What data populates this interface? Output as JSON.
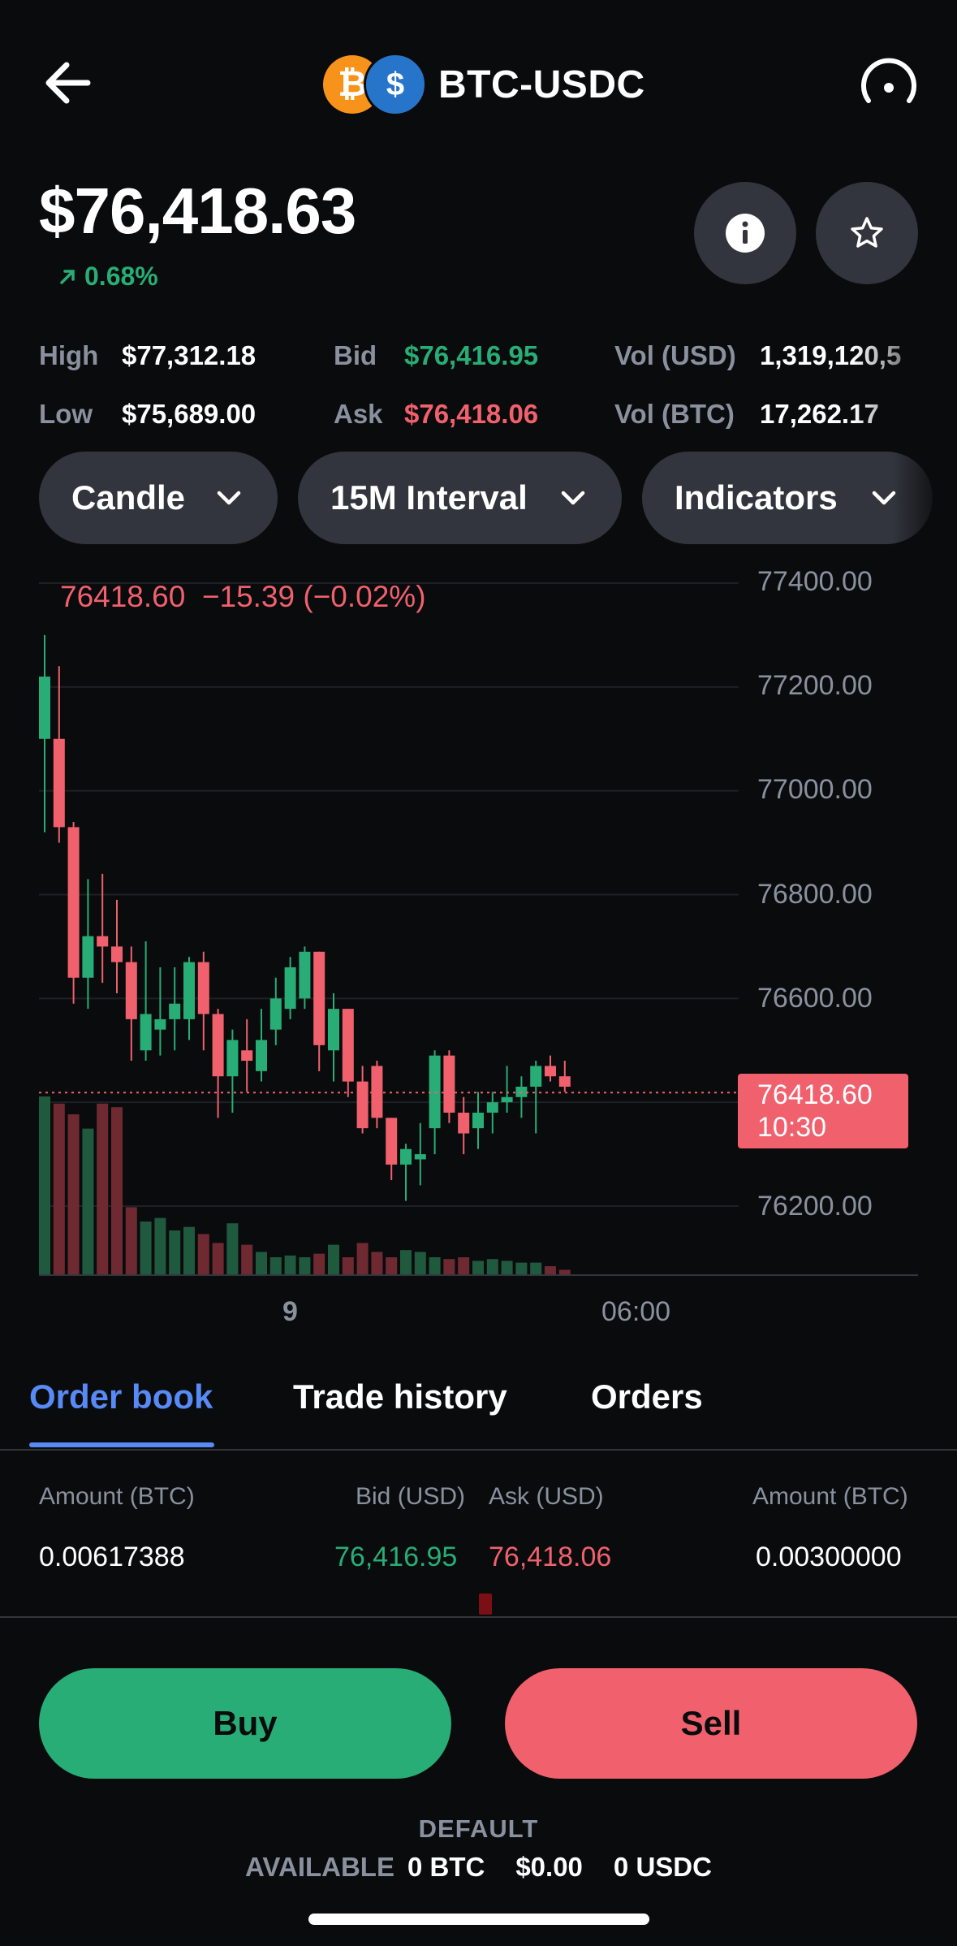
{
  "header": {
    "pair": "BTC-USDC",
    "base_symbol": "₿",
    "quote_symbol": "$"
  },
  "price": {
    "value": "$76,418.63",
    "change": "0.68%"
  },
  "stats": {
    "high_label": "High",
    "high_value": "$77,312.18",
    "low_label": "Low",
    "low_value": "$75,689.00",
    "bid_label": "Bid",
    "bid_value": "$76,416.95",
    "ask_label": "Ask",
    "ask_value": "$76,418.06",
    "vol_usd_label": "Vol (USD)",
    "vol_usd_value": "1,319,120,5",
    "vol_btc_label": "Vol (BTC)",
    "vol_btc_value": "17,262.17"
  },
  "controls": {
    "chart_type": "Candle",
    "interval": "15M Interval",
    "indicators": "Indicators"
  },
  "chart": {
    "ohlc_text": "76418.60  −15.39 (−0.02%)",
    "y_labels": [
      "77400.00",
      "77200.00",
      "77000.00",
      "76800.00",
      "76600.00",
      "76200.00"
    ],
    "x_labels": [
      "9",
      "06:00"
    ],
    "price_tag_value": "76418.60",
    "price_tag_time": "10:30",
    "colors": {
      "up": "#27ad75",
      "down": "#f0616d"
    }
  },
  "tabs": [
    "Order book",
    "Trade history",
    "Orders"
  ],
  "order_book": {
    "headers": [
      "Amount (BTC)",
      "Bid (USD)",
      "Ask (USD)",
      "Amount (BTC)"
    ],
    "row": [
      "0.00617388",
      "76,416.95",
      "76,418.06",
      "0.00300000"
    ]
  },
  "actions": {
    "buy": "Buy",
    "sell": "Sell"
  },
  "account": {
    "portfolio": "DEFAULT",
    "available_label": "AVAILABLE",
    "btc": "0 BTC",
    "usd": "$0.00",
    "usdc": "0 USDC"
  },
  "chart_data": {
    "type": "candlestick",
    "ylim": [
      76150,
      77420
    ],
    "last_price": 76418.6,
    "candles": [
      {
        "o": 77100,
        "h": 77300,
        "l": 76920,
        "c": 77220
      },
      {
        "o": 77100,
        "h": 77240,
        "l": 76900,
        "c": 76930
      },
      {
        "o": 76930,
        "h": 76940,
        "l": 76590,
        "c": 76640
      },
      {
        "o": 76640,
        "h": 76830,
        "l": 76580,
        "c": 76720
      },
      {
        "o": 76720,
        "h": 76840,
        "l": 76630,
        "c": 76700
      },
      {
        "o": 76700,
        "h": 76790,
        "l": 76610,
        "c": 76670
      },
      {
        "o": 76670,
        "h": 76700,
        "l": 76480,
        "c": 76560
      },
      {
        "o": 76500,
        "h": 76710,
        "l": 76480,
        "c": 76570
      },
      {
        "o": 76540,
        "h": 76660,
        "l": 76490,
        "c": 76560
      },
      {
        "o": 76560,
        "h": 76660,
        "l": 76500,
        "c": 76590
      },
      {
        "o": 76560,
        "h": 76680,
        "l": 76520,
        "c": 76670
      },
      {
        "o": 76670,
        "h": 76690,
        "l": 76500,
        "c": 76570
      },
      {
        "o": 76570,
        "h": 76580,
        "l": 76370,
        "c": 76450
      },
      {
        "o": 76450,
        "h": 76540,
        "l": 76380,
        "c": 76520
      },
      {
        "o": 76500,
        "h": 76560,
        "l": 76420,
        "c": 76480
      },
      {
        "o": 76460,
        "h": 76580,
        "l": 76440,
        "c": 76520
      },
      {
        "o": 76540,
        "h": 76640,
        "l": 76510,
        "c": 76600
      },
      {
        "o": 76580,
        "h": 76680,
        "l": 76560,
        "c": 76660
      },
      {
        "o": 76600,
        "h": 76700,
        "l": 76580,
        "c": 76690
      },
      {
        "o": 76690,
        "h": 76690,
        "l": 76460,
        "c": 76510
      },
      {
        "o": 76500,
        "h": 76610,
        "l": 76440,
        "c": 76580
      },
      {
        "o": 76580,
        "h": 76580,
        "l": 76410,
        "c": 76440
      },
      {
        "o": 76440,
        "h": 76470,
        "l": 76340,
        "c": 76350
      },
      {
        "o": 76470,
        "h": 76480,
        "l": 76350,
        "c": 76370
      },
      {
        "o": 76370,
        "h": 76370,
        "l": 76250,
        "c": 76280
      },
      {
        "o": 76280,
        "h": 76320,
        "l": 76210,
        "c": 76310
      },
      {
        "o": 76290,
        "h": 76360,
        "l": 76240,
        "c": 76300
      },
      {
        "o": 76350,
        "h": 76500,
        "l": 76300,
        "c": 76490
      },
      {
        "o": 76490,
        "h": 76500,
        "l": 76360,
        "c": 76380
      },
      {
        "o": 76380,
        "h": 76410,
        "l": 76300,
        "c": 76340
      },
      {
        "o": 76350,
        "h": 76420,
        "l": 76310,
        "c": 76380
      },
      {
        "o": 76380,
        "h": 76420,
        "l": 76340,
        "c": 76400
      },
      {
        "o": 76400,
        "h": 76470,
        "l": 76380,
        "c": 76410
      },
      {
        "o": 76410,
        "h": 76450,
        "l": 76370,
        "c": 76430
      },
      {
        "o": 76430,
        "h": 76480,
        "l": 76340,
        "c": 76470
      },
      {
        "o": 76470,
        "h": 76490,
        "l": 76440,
        "c": 76450
      },
      {
        "o": 76450,
        "h": 76480,
        "l": 76420,
        "c": 76430
      }
    ],
    "volumes": [
      1.0,
      0.96,
      0.9,
      0.82,
      0.96,
      0.94,
      0.38,
      0.3,
      0.32,
      0.25,
      0.27,
      0.23,
      0.18,
      0.29,
      0.17,
      0.13,
      0.1,
      0.11,
      0.1,
      0.12,
      0.17,
      0.1,
      0.18,
      0.13,
      0.1,
      0.14,
      0.13,
      0.1,
      0.09,
      0.1,
      0.08,
      0.09,
      0.08,
      0.07,
      0.07,
      0.05,
      0.03
    ]
  }
}
